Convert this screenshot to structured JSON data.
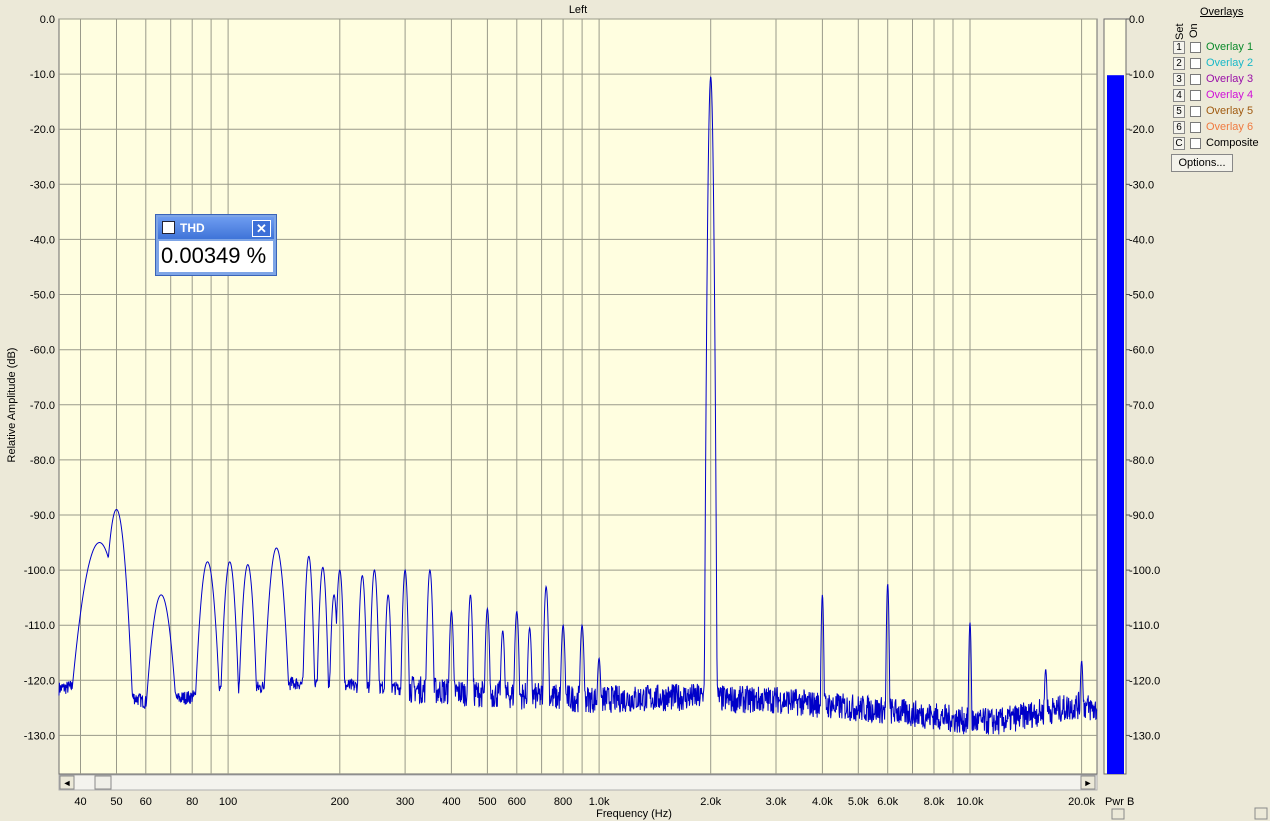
{
  "chart_data": {
    "type": "line",
    "title": "Left",
    "xlabel": "Frequency (Hz)",
    "ylabel": "Relative Amplitude (dB)",
    "x_scale": "log",
    "xlim": [
      35,
      22000
    ],
    "ylim": [
      -137,
      0
    ],
    "grid": true,
    "xticks": [
      {
        "v": 40,
        "label": "40"
      },
      {
        "v": 50,
        "label": "50"
      },
      {
        "v": 60,
        "label": "60"
      },
      {
        "v": 80,
        "label": "80"
      },
      {
        "v": 100,
        "label": "100"
      },
      {
        "v": 200,
        "label": "200"
      },
      {
        "v": 300,
        "label": "300"
      },
      {
        "v": 400,
        "label": "400"
      },
      {
        "v": 500,
        "label": "500"
      },
      {
        "v": 600,
        "label": "600"
      },
      {
        "v": 800,
        "label": "800"
      },
      {
        "v": 1000,
        "label": "1.0k"
      },
      {
        "v": 2000,
        "label": "2.0k"
      },
      {
        "v": 3000,
        "label": "3.0k"
      },
      {
        "v": 4000,
        "label": "4.0k"
      },
      {
        "v": 5000,
        "label": "5.0k"
      },
      {
        "v": 6000,
        "label": "6.0k"
      },
      {
        "v": 8000,
        "label": "8.0k"
      },
      {
        "v": 10000,
        "label": "10.0k"
      },
      {
        "v": 20000,
        "label": "20.0k"
      }
    ],
    "yticks": [
      {
        "v": 0,
        "label": "0.0"
      },
      {
        "v": -10,
        "label": "-10.0"
      },
      {
        "v": -20,
        "label": "-20.0"
      },
      {
        "v": -30,
        "label": "-30.0"
      },
      {
        "v": -40,
        "label": "-40.0"
      },
      {
        "v": -50,
        "label": "-50.0"
      },
      {
        "v": -60,
        "label": "-60.0"
      },
      {
        "v": -70,
        "label": "-70.0"
      },
      {
        "v": -80,
        "label": "-80.0"
      },
      {
        "v": -90,
        "label": "-90.0"
      },
      {
        "v": -100,
        "label": "-100.0"
      },
      {
        "v": -110,
        "label": "-110.0"
      },
      {
        "v": -120,
        "label": "-120.0"
      },
      {
        "v": -130,
        "label": "-130.0"
      }
    ],
    "series": [
      {
        "color": "#0000c8",
        "baseline": [
          [
            35,
            -121.5
          ],
          [
            40,
            -121
          ],
          [
            43,
            -120
          ],
          [
            60,
            -124
          ],
          [
            80,
            -123
          ],
          [
            100,
            -122
          ],
          [
            150,
            -120.5
          ],
          [
            300,
            -121.5
          ],
          [
            500,
            -122.5
          ],
          [
            1000,
            -123.5
          ],
          [
            1800,
            -123
          ],
          [
            2300,
            -123.5
          ],
          [
            3000,
            -123.5
          ],
          [
            4000,
            -124.5
          ],
          [
            6000,
            -125.5
          ],
          [
            8000,
            -126.5
          ],
          [
            10000,
            -127.5
          ],
          [
            12000,
            -127.5
          ],
          [
            15000,
            -126
          ],
          [
            20000,
            -124.5
          ],
          [
            22000,
            -125.5
          ]
        ],
        "peaks": [
          {
            "x": 45,
            "y": -95,
            "w": 0.035
          },
          {
            "x": 50,
            "y": -89,
            "w": 0.018
          },
          {
            "x": 66,
            "y": -104.5,
            "w": 0.022
          },
          {
            "x": 88,
            "y": -98.5,
            "w": 0.016
          },
          {
            "x": 101,
            "y": -98.5,
            "w": 0.012
          },
          {
            "x": 113,
            "y": -99,
            "w": 0.012
          },
          {
            "x": 135,
            "y": -96,
            "w": 0.016
          },
          {
            "x": 165,
            "y": -97.5,
            "w": 0.008
          },
          {
            "x": 180,
            "y": -99.5,
            "w": 0.008
          },
          {
            "x": 193,
            "y": -104.5,
            "w": 0.007
          },
          {
            "x": 200,
            "y": -100,
            "w": 0.007
          },
          {
            "x": 230,
            "y": -101,
            "w": 0.007
          },
          {
            "x": 248,
            "y": -100,
            "w": 0.007
          },
          {
            "x": 270,
            "y": -104.5,
            "w": 0.006
          },
          {
            "x": 300,
            "y": -100,
            "w": 0.006
          },
          {
            "x": 350,
            "y": -100,
            "w": 0.006
          },
          {
            "x": 400,
            "y": -107.5,
            "w": 0.005
          },
          {
            "x": 450,
            "y": -104.5,
            "w": 0.005
          },
          {
            "x": 500,
            "y": -107,
            "w": 0.005
          },
          {
            "x": 550,
            "y": -111,
            "w": 0.005
          },
          {
            "x": 600,
            "y": -107.5,
            "w": 0.005
          },
          {
            "x": 650,
            "y": -110.5,
            "w": 0.005
          },
          {
            "x": 720,
            "y": -103,
            "w": 0.005
          },
          {
            "x": 800,
            "y": -110,
            "w": 0.005
          },
          {
            "x": 900,
            "y": -110,
            "w": 0.005
          },
          {
            "x": 1000,
            "y": -116,
            "w": 0.005
          },
          {
            "x": 2000,
            "y": -10.5,
            "w": 0.004
          },
          {
            "x": 4000,
            "y": -104.5,
            "w": 0.003
          },
          {
            "x": 6000,
            "y": -102.5,
            "w": 0.003
          },
          {
            "x": 10000,
            "y": -109.5,
            "w": 0.003
          },
          {
            "x": 16000,
            "y": -118,
            "w": 0.004
          },
          {
            "x": 20000,
            "y": -116.5,
            "w": 0.004
          }
        ]
      }
    ],
    "meter": {
      "label": "Pwr B",
      "value": -10.2,
      "ylim": [
        -137,
        0
      ]
    }
  },
  "thd": {
    "title": "THD",
    "value": "0.00349 %",
    "close_glyph": "✕"
  },
  "overlays": {
    "heading": "Overlays",
    "set_label": "Set",
    "on_label": "On",
    "items": [
      {
        "num": "1",
        "label": "Overlay 1",
        "color": "#0a8a2a"
      },
      {
        "num": "2",
        "label": "Overlay 2",
        "color": "#18b8c8"
      },
      {
        "num": "3",
        "label": "Overlay 3",
        "color": "#9a10a8"
      },
      {
        "num": "4",
        "label": "Overlay 4",
        "color": "#d010d8"
      },
      {
        "num": "5",
        "label": "Overlay 5",
        "color": "#a05a10"
      },
      {
        "num": "6",
        "label": "Overlay 6",
        "color": "#f07a40"
      },
      {
        "num": "C",
        "label": "Composite",
        "color": "#000000"
      }
    ],
    "options_label": "Options..."
  },
  "scrollbar": {
    "left_arrow": "◄",
    "right_arrow": "►"
  }
}
